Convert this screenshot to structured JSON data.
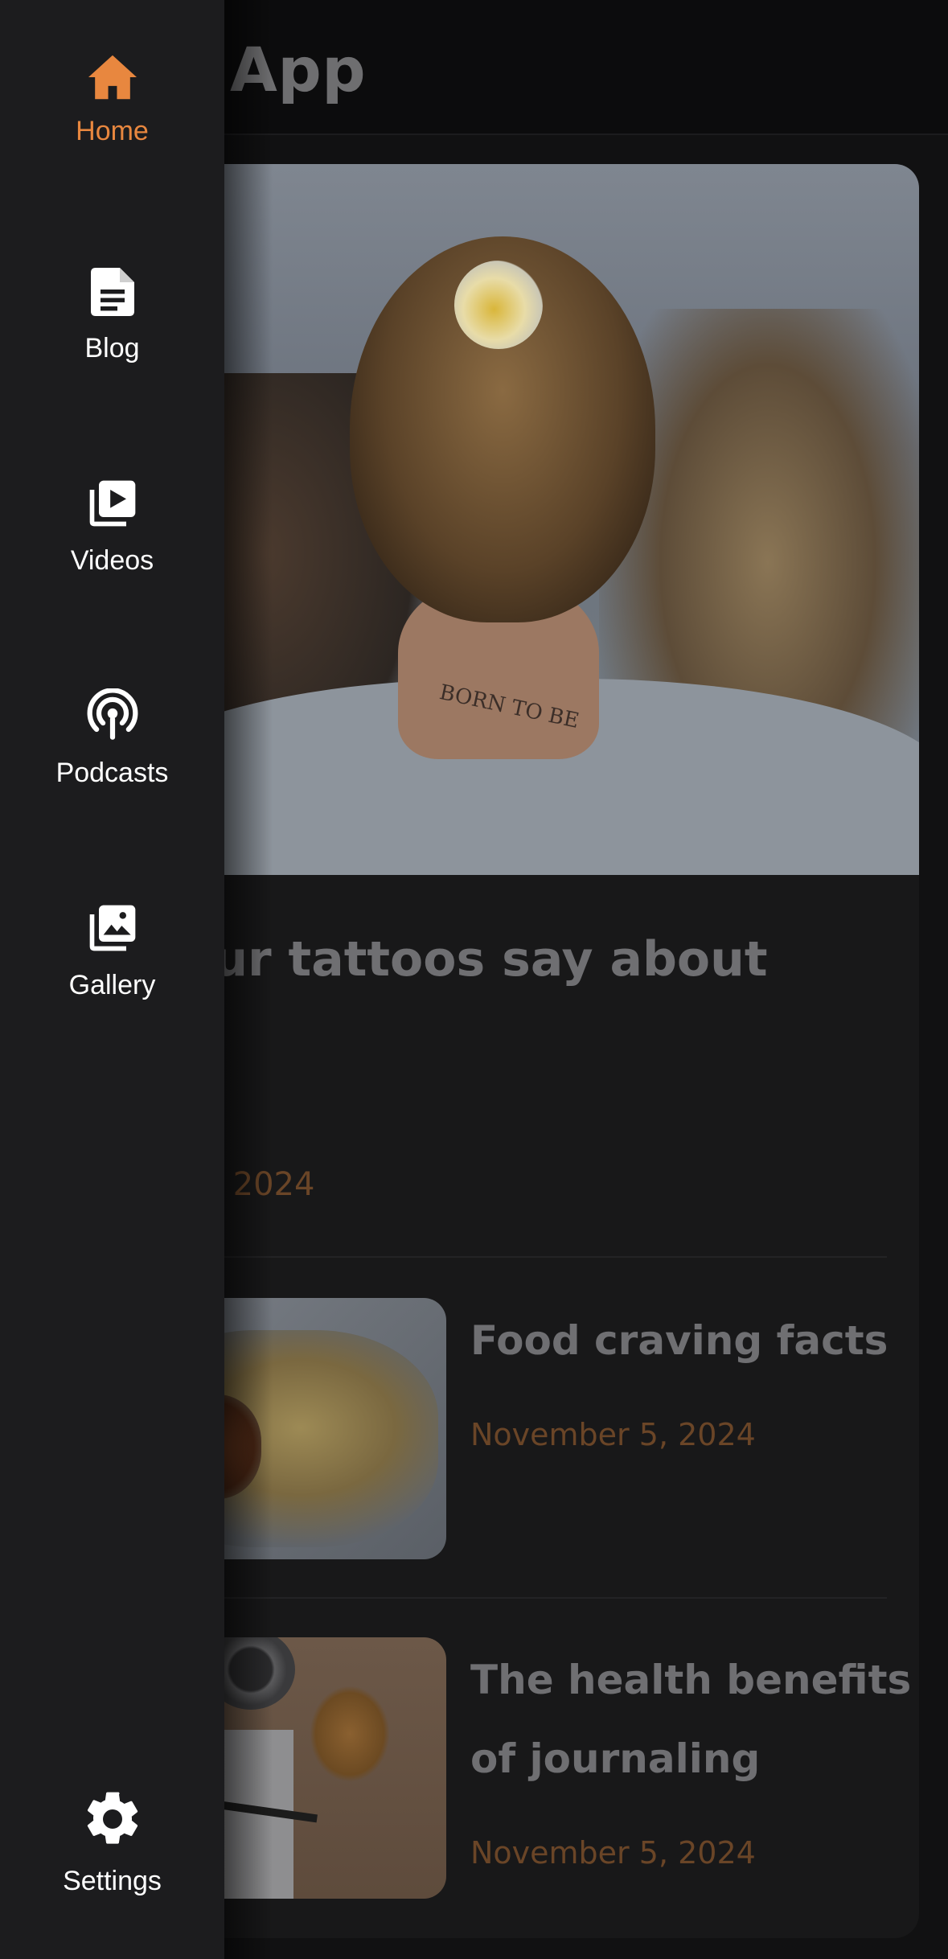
{
  "header": {
    "title": "App"
  },
  "featured": {
    "title": "your tattoos say about",
    "date": "er 5, 2024",
    "image_text": "BORN TO BE"
  },
  "posts": [
    {
      "title_lines": [
        "Food craving facts"
      ],
      "date": "November 5, 2024"
    },
    {
      "title_lines": [
        "The health benefits",
        "of journaling"
      ],
      "date": "November 5, 2024"
    }
  ],
  "drawer": {
    "items": [
      {
        "label": "Home",
        "icon": "home-icon",
        "active": true
      },
      {
        "label": "Blog",
        "icon": "document-icon",
        "active": false
      },
      {
        "label": "Videos",
        "icon": "video-library-icon",
        "active": false
      },
      {
        "label": "Podcasts",
        "icon": "podcast-icon",
        "active": false
      },
      {
        "label": "Gallery",
        "icon": "photo-library-icon",
        "active": false
      }
    ],
    "footer": {
      "label": "Settings",
      "icon": "gear-icon"
    }
  },
  "colors": {
    "accent": "#e8873f",
    "drawer_bg": "#1c1c1e",
    "page_bg": "#111112",
    "muted_date": "#6a4527"
  }
}
